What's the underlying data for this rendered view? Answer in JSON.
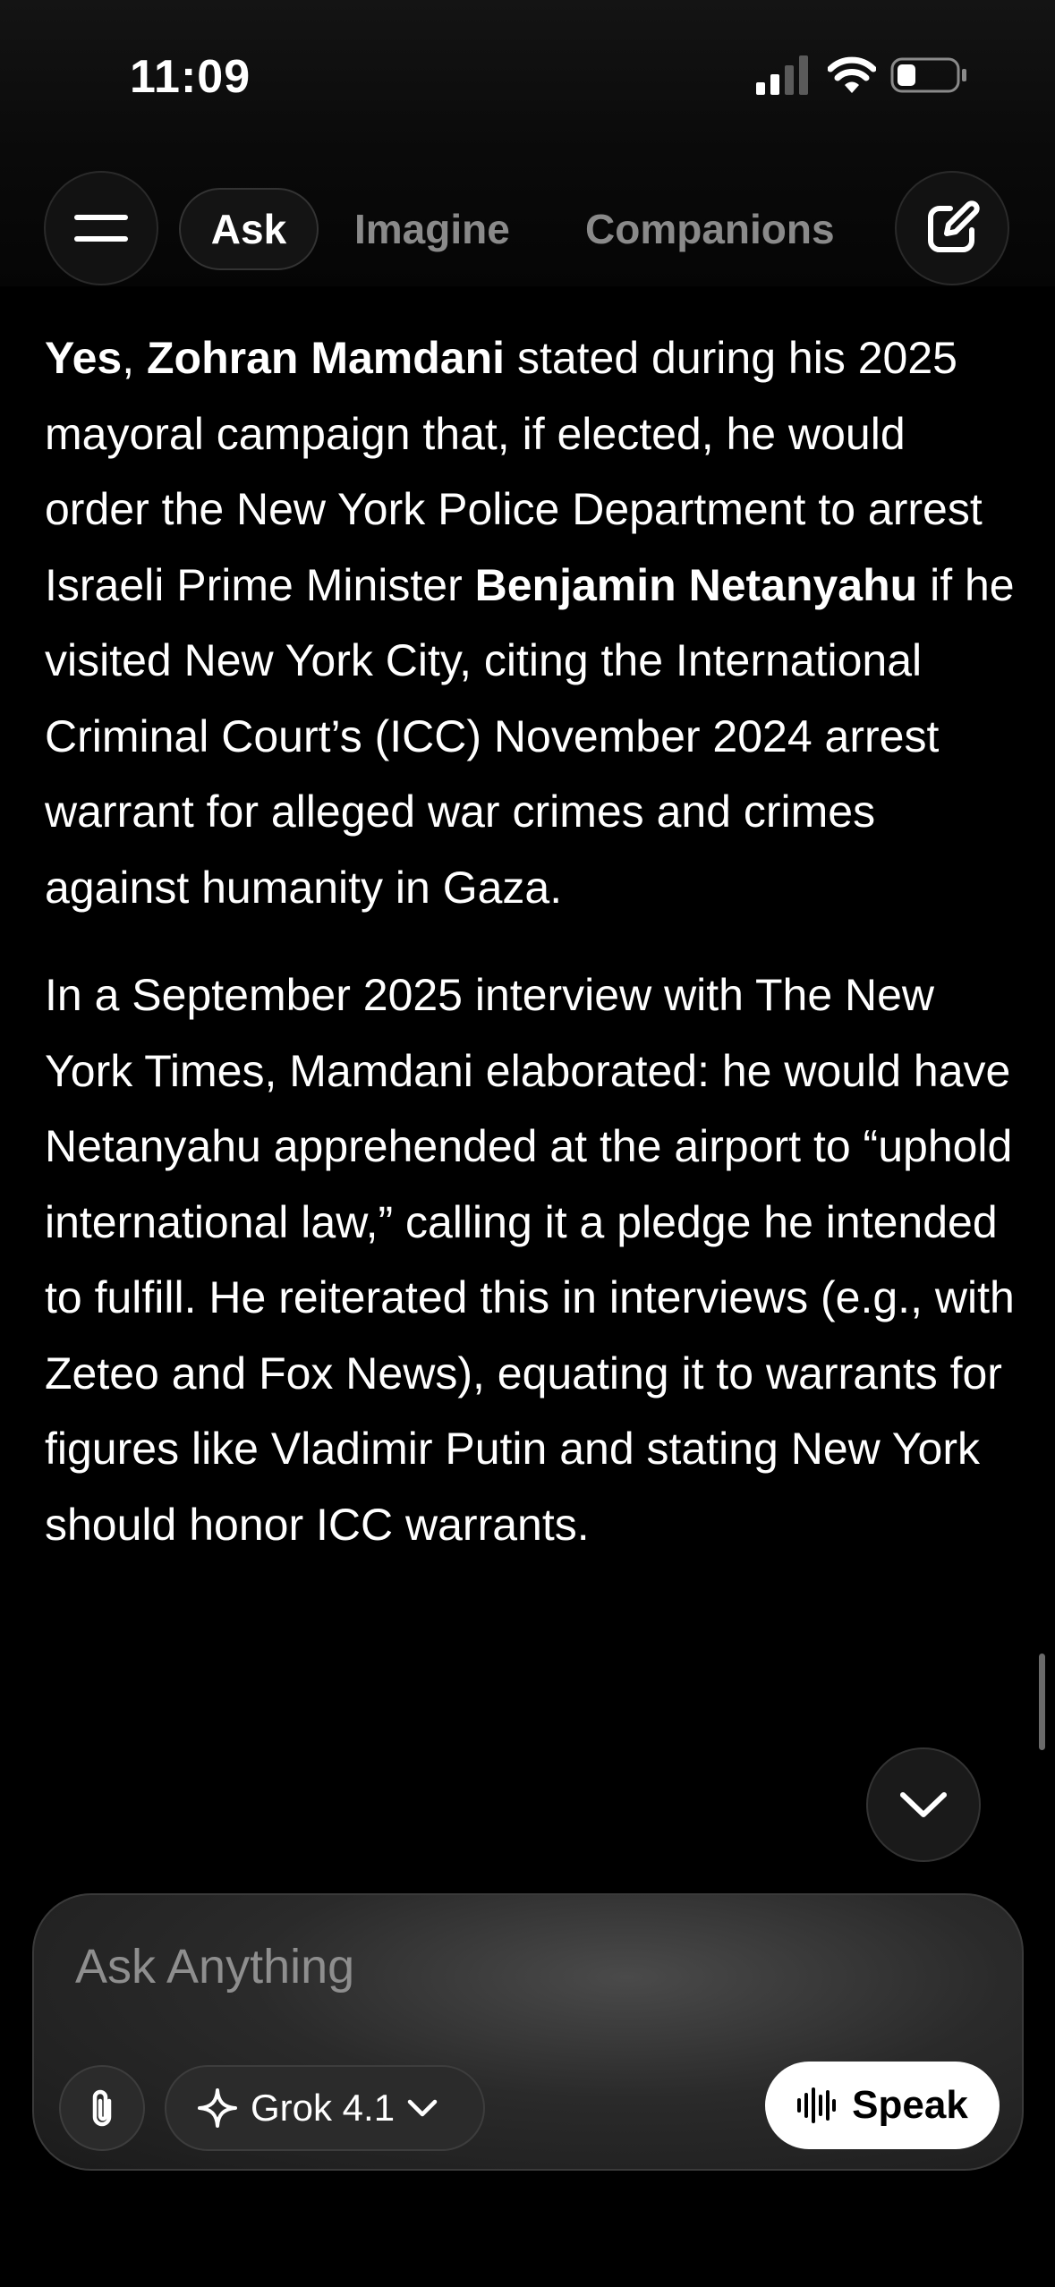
{
  "status_bar": {
    "time": "11:09"
  },
  "header": {
    "tabs": [
      {
        "label": "Ask",
        "active": true
      },
      {
        "label": "Imagine",
        "active": false
      },
      {
        "label": "Companions",
        "active": false
      }
    ],
    "menu_icon": "hamburger-menu-icon",
    "new_chat_icon": "pencil-square-icon"
  },
  "message": {
    "p1": {
      "s1": "Yes",
      "s2": ", ",
      "s3": "Zohran Mamdani",
      "s4": " stated during his 2025 mayoral campaign that, if elected, he would order the New York Police Department to arrest Israeli Prime Minister ",
      "s5": "Benjamin Netanyahu",
      "s6": " if he visited New York City, citing the International Criminal Court’s (ICC) November 2024 arrest warrant for alleged war crimes and crimes against humanity in Gaza."
    },
    "p2": "In a September 2025 interview with The New York Times, Mamdani elaborated: he would have Netanyahu apprehended at the airport to “uphold international law,” calling it a pledge he intended to fulfill. He reiterated this in interviews (e.g., with Zeteo and Fox News), equating it to warrants for figures like Vladimir Putin and stating New York should honor ICC warrants."
  },
  "composer": {
    "placeholder": "Ask Anything",
    "value": "",
    "model_label": "Grok 4.1",
    "speak_label": "Speak",
    "attach_icon": "paperclip-icon",
    "model_icon": "sparkle-icon",
    "dropdown_icon": "chevron-down-icon",
    "speak_icon": "waveform-icon"
  },
  "colors": {
    "background": "#000000",
    "text": "#ffffff",
    "muted_text": "#8a8a8a",
    "speak_button_bg": "#ffffff"
  }
}
